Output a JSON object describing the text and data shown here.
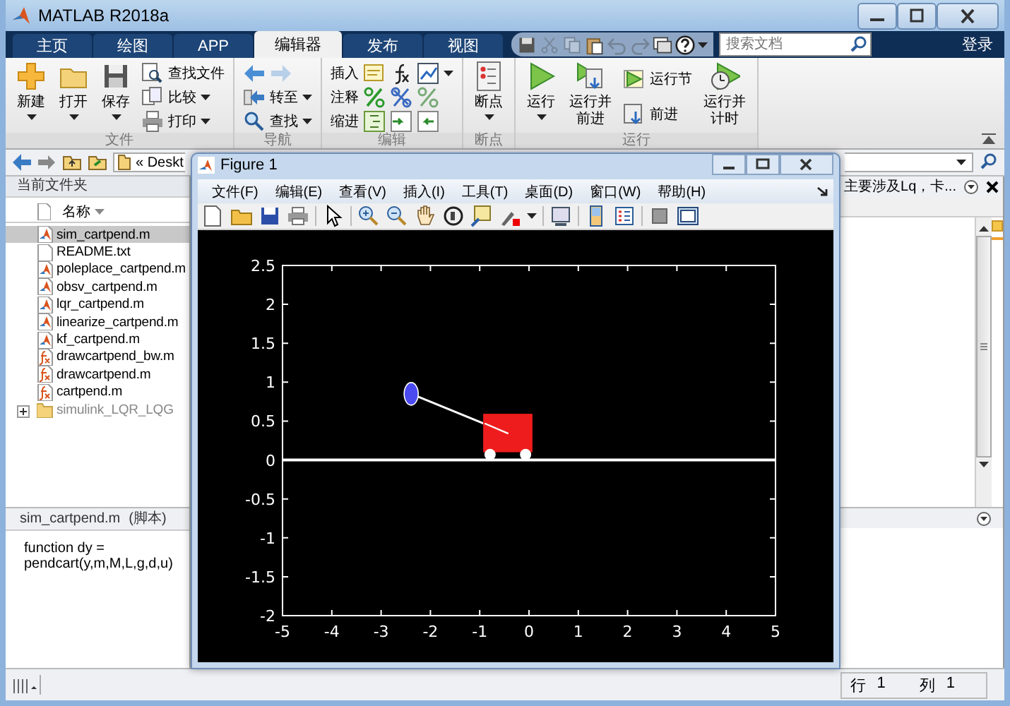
{
  "window": {
    "title": "MATLAB R2018a"
  },
  "tabs": [
    {
      "label": "主页",
      "selected": false
    },
    {
      "label": "绘图",
      "selected": false
    },
    {
      "label": "APP",
      "selected": false
    },
    {
      "label": "编辑器",
      "selected": true
    },
    {
      "label": "发布",
      "selected": false
    },
    {
      "label": "视图",
      "selected": false
    }
  ],
  "quick_access": {
    "buttons": [
      {
        "disabled": false
      },
      {
        "disabled": true
      },
      {
        "disabled": true
      },
      {
        "disabled": false
      },
      {
        "disabled": true
      },
      {
        "disabled": true
      },
      {
        "disabled": false
      },
      {
        "disabled": false
      }
    ],
    "search": {
      "placeholder": "搜索文档"
    },
    "login_button": "登录"
  },
  "ribbon": {
    "groups": [
      {
        "label": "文件",
        "items": [
          {
            "kind": "large",
            "label": "新建",
            "menu": true
          },
          {
            "kind": "large",
            "label": "打开",
            "menu": true
          },
          {
            "kind": "large",
            "label": "保存",
            "menu": true
          },
          {
            "kind": "column",
            "rows": [
              {
                "label": "查找文件",
                "menu": false,
                "icons": [
                  {
                    "disabled": false
                  }
                ]
              },
              {
                "label": "比较",
                "menu": true,
                "icons": [
                  {
                    "disabled": false
                  }
                ]
              },
              {
                "label": "打印",
                "menu": true,
                "icons": [
                  {
                    "disabled": false
                  }
                ]
              }
            ]
          }
        ]
      },
      {
        "label": "导航",
        "items": [
          {
            "kind": "column",
            "rows": [
              {
                "menu": false,
                "icons": [
                  {
                    "disabled": false
                  },
                  {
                    "disabled": true
                  }
                ]
              },
              {
                "label": "转至",
                "menu": true,
                "icons": [
                  {
                    "disabled": false
                  }
                ]
              },
              {
                "label": "查找",
                "menu": true,
                "icons": [
                  {
                    "disabled": false
                  }
                ]
              }
            ]
          }
        ]
      },
      {
        "label": "编辑",
        "items": [
          {
            "kind": "column",
            "rows": [
              {
                "label": "插入",
                "menu": true,
                "icons": [
                  {
                    "disabled": false
                  },
                  {
                    "disabled": false
                  },
                  {
                    "disabled": false
                  }
                ]
              },
              {
                "label": "注释",
                "menu": false,
                "icons": [
                  {
                    "disabled": false
                  },
                  {
                    "disabled": false
                  },
                  {
                    "disabled": false
                  }
                ]
              },
              {
                "label": "缩进",
                "menu": false,
                "icons": [
                  {
                    "disabled": false
                  },
                  {
                    "disabled": false
                  },
                  {
                    "disabled": false
                  }
                ]
              }
            ]
          }
        ]
      },
      {
        "label": "断点",
        "items": [
          {
            "kind": "large",
            "label": "断点",
            "menu": true
          }
        ]
      },
      {
        "label": "运行",
        "items": [
          {
            "kind": "large",
            "label": "运行",
            "menu": true
          },
          {
            "kind": "large",
            "label": "运行并前进",
            "menu": false
          },
          {
            "kind": "column",
            "rows": [
              {
                "label": "运行节",
                "menu": false,
                "icons": [
                  {
                    "disabled": false
                  }
                ]
              },
              {
                "label": "前进",
                "menu": false,
                "icons": [
                  {
                    "disabled": false
                  }
                ]
              }
            ]
          },
          {
            "kind": "large",
            "label": "运行并计时",
            "menu": false
          }
        ]
      }
    ]
  },
  "address_bar": {
    "path": "« Deskt"
  },
  "file_panel": {
    "title": "当前文件夹",
    "column": "名称",
    "files": [
      {
        "name": "sim_cartpend.m",
        "kind": "script",
        "selected": true
      },
      {
        "name": "README.txt",
        "kind": "text",
        "selected": false
      },
      {
        "name": "poleplace_cartpend.m",
        "kind": "script",
        "selected": false
      },
      {
        "name": "obsv_cartpend.m",
        "kind": "script",
        "selected": false
      },
      {
        "name": "lqr_cartpend.m",
        "kind": "script",
        "selected": false
      },
      {
        "name": "linearize_cartpend.m",
        "kind": "script",
        "selected": false
      },
      {
        "name": "kf_cartpend.m",
        "kind": "script",
        "selected": false
      },
      {
        "name": "drawcartpend_bw.m",
        "kind": "function",
        "selected": false
      },
      {
        "name": "drawcartpend.m",
        "kind": "function",
        "selected": false
      },
      {
        "name": "cartpend.m",
        "kind": "function",
        "selected": false
      },
      {
        "name": "simulink_LQR_LQG",
        "kind": "folder",
        "selected": false,
        "expanded": false
      }
    ]
  },
  "details": {
    "file": "sim_cartpend.m",
    "type": "(脚本)",
    "text": "function dy = pendcart(y,m,M,L,g,d,u)"
  },
  "editor": {
    "tab": "主要涉及Lq，卡..."
  },
  "status_bar": {
    "row_label": "行",
    "row": "1",
    "col_label": "列",
    "col": "1"
  },
  "figure": {
    "title": "Figure 1",
    "menu": [
      "文件(F)",
      "编辑(E)",
      "查看(V)",
      "插入(I)",
      "工具(T)",
      "桌面(D)",
      "窗口(W)",
      "帮助(H)"
    ],
    "chart_data": {
      "type": "line",
      "xlim": [
        -5,
        5
      ],
      "ylim": [
        -2,
        2.5
      ],
      "xticks": [
        -5,
        -4,
        -3,
        -2,
        -1,
        0,
        1,
        2,
        3,
        4,
        5
      ],
      "yticks": [
        -2,
        -1.5,
        -1,
        -0.5,
        0,
        0.5,
        1,
        1.5,
        2,
        2.5
      ],
      "x": [
        -5,
        5
      ],
      "series": [
        {
          "color": "#ffffff",
          "values": [
            0,
            0
          ]
        }
      ]
    }
  }
}
